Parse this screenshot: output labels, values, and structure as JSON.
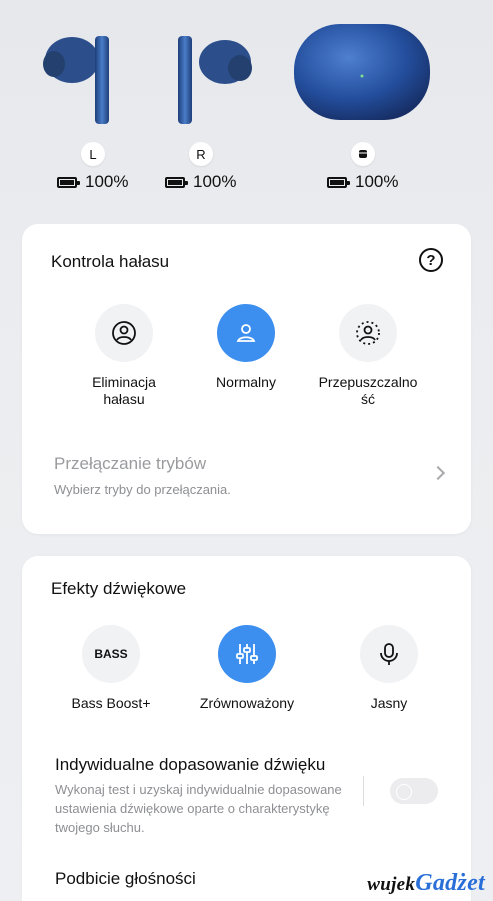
{
  "devices": {
    "left": {
      "label": "L",
      "battery": "100%"
    },
    "right": {
      "label": "R",
      "battery": "100%"
    },
    "case": {
      "battery": "100%"
    }
  },
  "noise_control": {
    "title": "Kontrola hałasu",
    "modes": [
      {
        "label": "Eliminacja\nhałasu",
        "active": false
      },
      {
        "label": "Normalny",
        "active": true
      },
      {
        "label": "Przepuszczalno\nść",
        "active": false
      }
    ],
    "mode_switch": {
      "title": "Przełączanie trybów",
      "subtitle": "Wybierz tryby do przełączania."
    }
  },
  "sound_effects": {
    "title": "Efekty dźwiękowe",
    "modes": [
      {
        "label": "Bass Boost+",
        "icon_text": "BASS",
        "active": false
      },
      {
        "label": "Zrównoważony",
        "active": true
      },
      {
        "label": "Jasny",
        "active": false
      }
    ],
    "individual": {
      "title": "Indywidualne dopasowanie dźwięku",
      "description": "Wykonaj test i uzyskaj indywidualnie dopasowane ustawienia dźwiękowe oparte o charakterystykę twojego słuchu.",
      "enabled": false
    },
    "volume_boost_title": "Podbicie głośności"
  },
  "watermark": {
    "part1": "wujek",
    "part2": "Gadżet"
  },
  "colors": {
    "accent": "#3d8fef",
    "earbud": "#2f5fa8",
    "case": "#274f9c"
  }
}
